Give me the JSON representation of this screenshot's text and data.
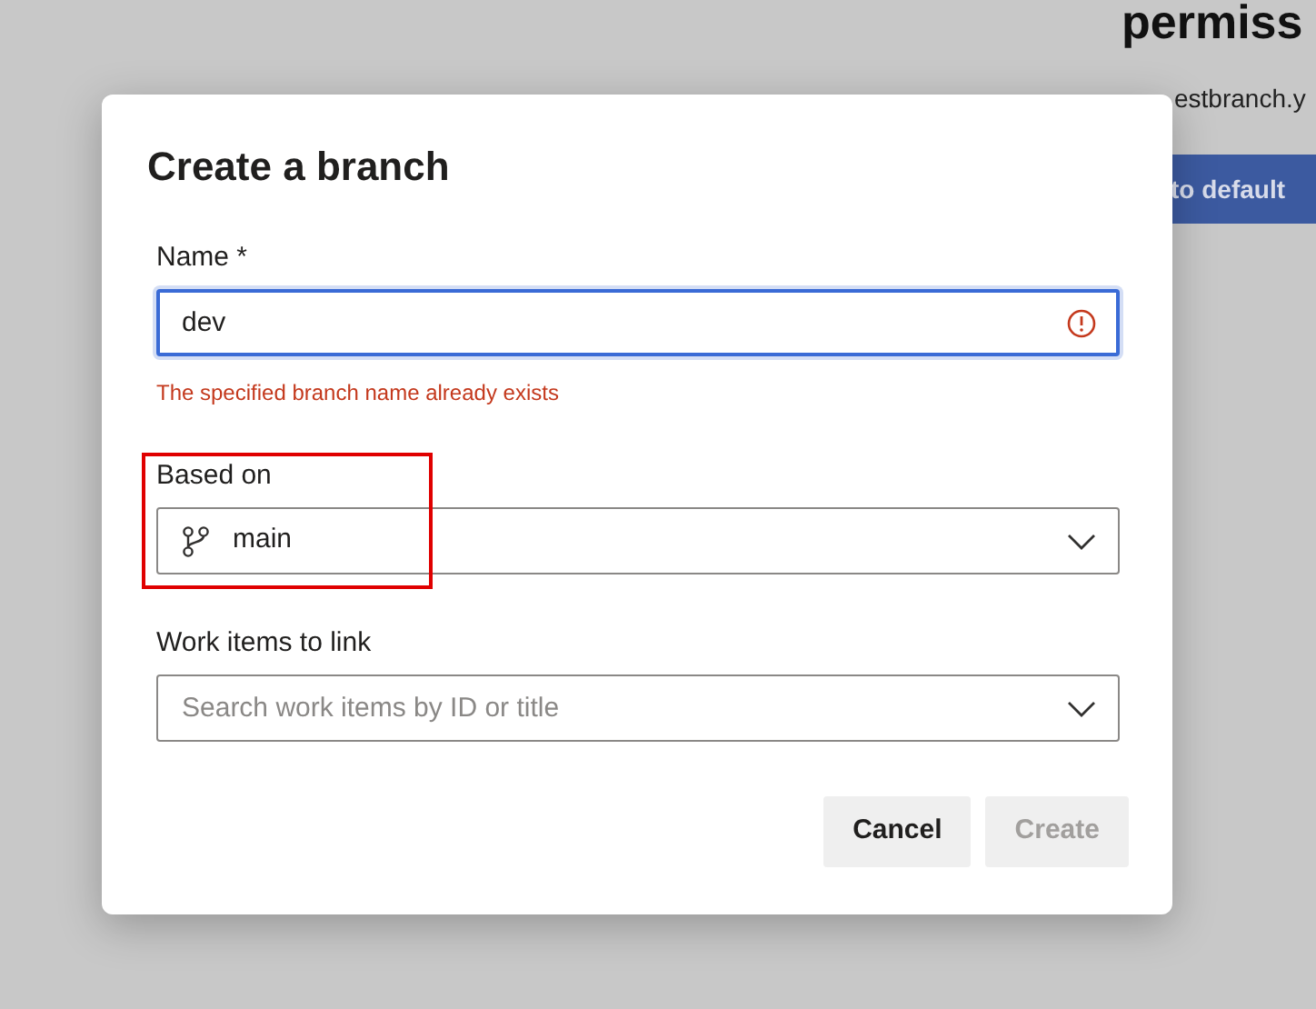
{
  "background": {
    "heading": "permiss",
    "text": "estbranch.y",
    "button": "to default"
  },
  "dialog": {
    "title": "Create a branch",
    "name_field": {
      "label": "Name *",
      "value": "dev",
      "focused": true,
      "invalid": true,
      "error": "The specified branch name already exists"
    },
    "based_on": {
      "label": "Based on",
      "value": "main",
      "highlighted": true
    },
    "work_items": {
      "label": "Work items to link",
      "placeholder": "Search work items by ID or title"
    },
    "buttons": [
      {
        "label": "Cancel",
        "disabled": false
      },
      {
        "label": "Create",
        "disabled": true
      }
    ]
  }
}
